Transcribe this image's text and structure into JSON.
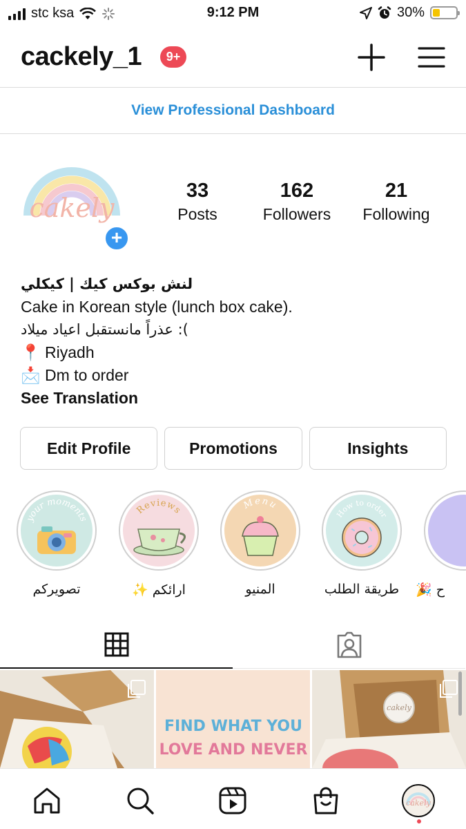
{
  "status_bar": {
    "carrier": "stc ksa",
    "time": "9:12 PM",
    "battery": "30%",
    "battery_level": 0.3
  },
  "header": {
    "username": "cackely_1",
    "notification_badge": "9+"
  },
  "pro_dashboard": {
    "label": "View Professional Dashboard",
    "color": "#2a8fd8"
  },
  "profile": {
    "avatar_logo_text": "cakely",
    "stats": {
      "posts_count": "33",
      "posts_label": "Posts",
      "followers_count": "162",
      "followers_label": "Followers",
      "following_count": "21",
      "following_label": "Following"
    },
    "bio": {
      "name": "لنش بوكس كيك | كيكلي",
      "line1": "Cake in Korean style (lunch box cake).",
      "line2": "): عذراً مانستقبل اعياد ميلاد",
      "line3": "📍 Riyadh",
      "line4": "📩 Dm to order",
      "see_translation": "See Translation"
    }
  },
  "actions": {
    "edit_profile": "Edit Profile",
    "promotions": "Promotions",
    "insights": "Insights"
  },
  "highlights": [
    {
      "label": "تصويركم",
      "cover_text": "your moments",
      "color": "#cfe9e4"
    },
    {
      "label": "✨ ارائكم",
      "cover_text": "Reviews",
      "color": "#f6dce0"
    },
    {
      "label": "المنيو",
      "cover_text": "Menu",
      "color": "#f4d7b3"
    },
    {
      "label": "طريقة الطلب",
      "cover_text": "How to order",
      "color": "#d3ece9"
    },
    {
      "label": "🎉 ح",
      "cover_text": "",
      "color": "#c9c2f3"
    }
  ],
  "grid_posts": [
    {
      "kind": "photo",
      "multi": true
    },
    {
      "kind": "text",
      "line1": "FIND WHAT YOU",
      "line2": "LOVE AND NEVER",
      "multi": false
    },
    {
      "kind": "photo",
      "multi": true,
      "label": "cakely"
    }
  ],
  "colors": {
    "accent_blue": "#3897f0",
    "badge_red": "#ed4956"
  }
}
